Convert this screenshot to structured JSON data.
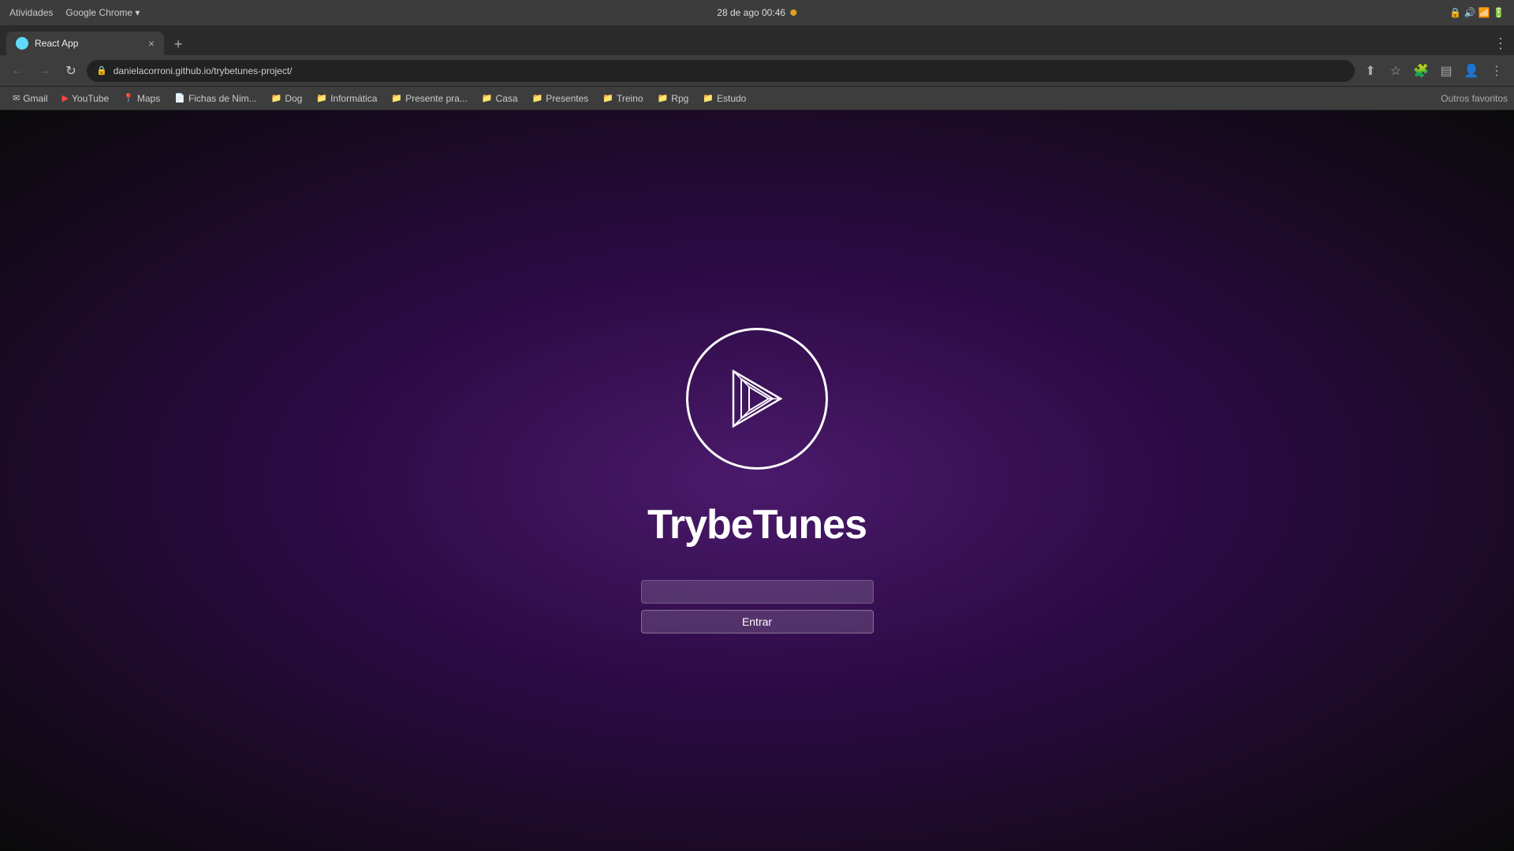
{
  "os": {
    "activities_label": "Atividades",
    "app_label": "Google Chrome",
    "datetime": "28 de ago  00:46",
    "dot_color": "#e0a020"
  },
  "chrome": {
    "window_title": "React App - Google Chrome",
    "tab": {
      "favicon_color": "#61dafb",
      "label": "React App",
      "close_icon": "×"
    },
    "new_tab_icon": "+",
    "nav": {
      "back_icon": "←",
      "forward_icon": "→",
      "reload_icon": "↻"
    },
    "address_bar": {
      "url": "danielacorroni.github.io/trybetunes-project/",
      "lock_icon": "🔒"
    },
    "bookmarks": [
      {
        "icon": "✉",
        "label": "Gmail"
      },
      {
        "icon": "▶",
        "label": "YouTube",
        "icon_color": "#ff0000"
      },
      {
        "icon": "📍",
        "label": "Maps"
      },
      {
        "icon": "📄",
        "label": "Fichas de Nim..."
      },
      {
        "icon": "📁",
        "label": "Dog"
      },
      {
        "icon": "📁",
        "label": "Informática"
      },
      {
        "icon": "📁",
        "label": "Presente pra..."
      },
      {
        "icon": "📁",
        "label": "Casa"
      },
      {
        "icon": "📁",
        "label": "Presentes"
      },
      {
        "icon": "📁",
        "label": "Treino"
      },
      {
        "icon": "📁",
        "label": "Rpg"
      },
      {
        "icon": "📁",
        "label": "Estudo"
      }
    ],
    "bookmarks_end": "Outros favoritos"
  },
  "app": {
    "title": "TrybeTunes",
    "login_input_placeholder": "",
    "login_button_label": "Entrar"
  }
}
